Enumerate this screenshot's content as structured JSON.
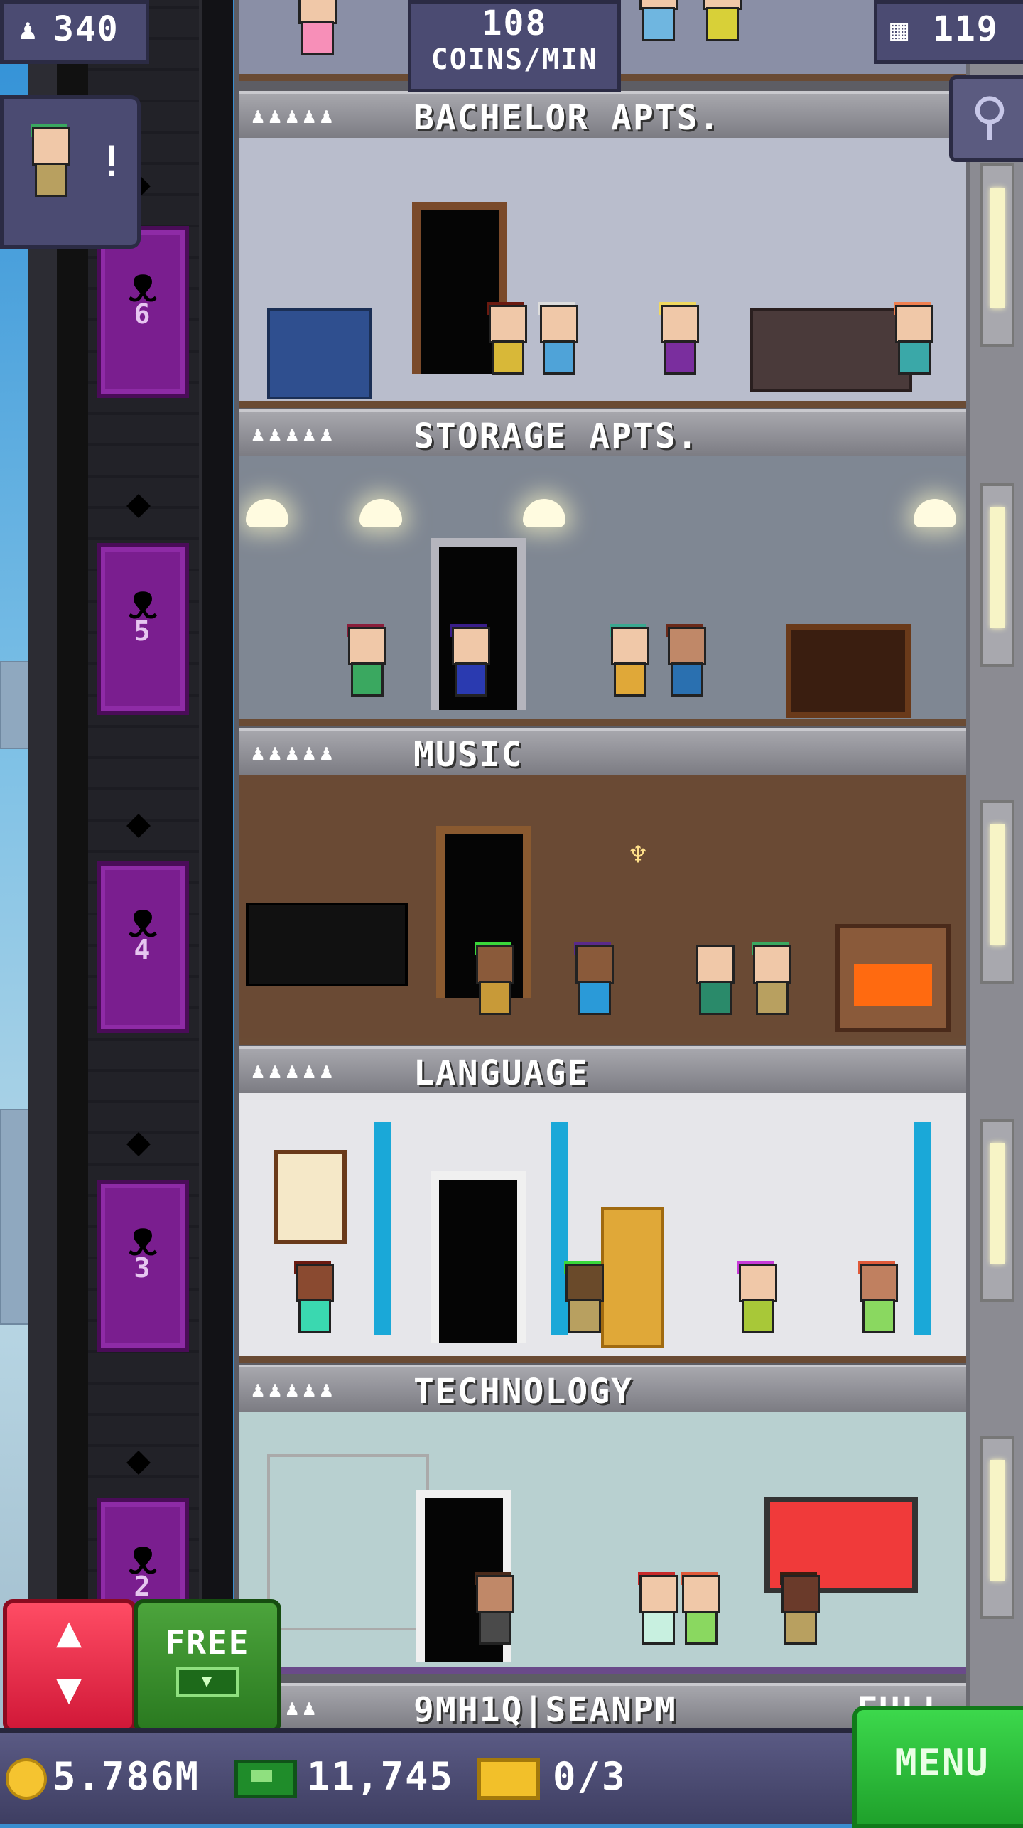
{
  "hud": {
    "population": "340",
    "coins_per_min_value": "108",
    "coins_per_min_unit": "COINS/MIN",
    "floor_count": "119",
    "visitor_alert": "!"
  },
  "elevator": {
    "floor_numbers": [
      "6",
      "5",
      "4",
      "3",
      "2"
    ]
  },
  "floors": [
    {
      "people": "♟♟♟♟♟",
      "name": "BACHELOR APTS."
    },
    {
      "people": "♟♟♟♟♟",
      "name": "STORAGE APTS."
    },
    {
      "people": "♟♟♟♟♟",
      "name": "MUSIC"
    },
    {
      "people": "♟♟♟♟♟",
      "name": "LANGUAGE"
    },
    {
      "people": "♟♟♟♟♟",
      "name": "TECHNOLOGY"
    },
    {
      "people": "♟♟♟♟",
      "name": "9MH1Q|SEANPM",
      "extra": "FULL"
    }
  ],
  "buttons": {
    "free_label": "FREE",
    "menu_label": "MENU"
  },
  "bottom": {
    "coins": "5.786M",
    "bux": "11,745",
    "tickets": "0/3"
  },
  "colors": {
    "elevator_car": "#7a1e8f",
    "menu_button": "#1fa12b",
    "elevator_button": "#d11838",
    "hud_panel": "#4b4b72"
  }
}
